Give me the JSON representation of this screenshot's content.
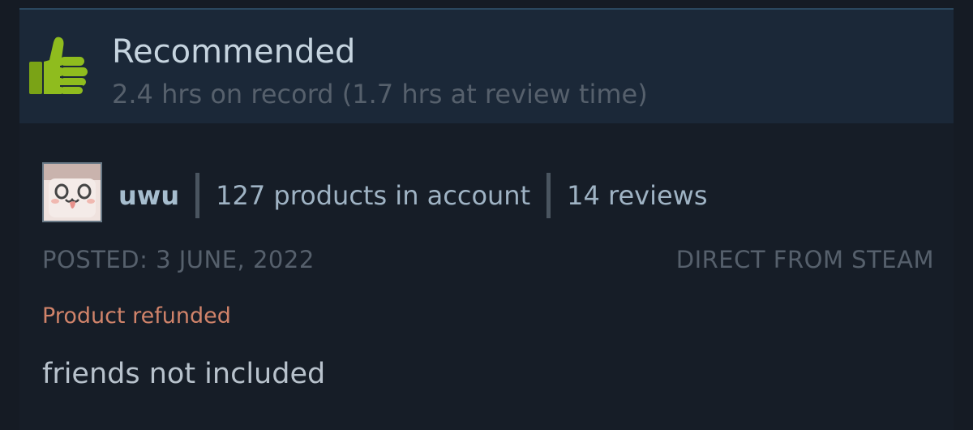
{
  "review": {
    "verdict": "Recommended",
    "hours": "2.4 hrs on record (1.7 hrs at review time)",
    "author": {
      "name": "uwu",
      "products": "127 products in account",
      "reviews": "14 reviews"
    },
    "posted": "POSTED: 3 JUNE, 2022",
    "source": "DIRECT FROM STEAM",
    "status": "Product refunded",
    "body": "friends not included"
  },
  "icons": {
    "verdict": "thumbs-up-icon",
    "avatar": "avatar"
  },
  "colors": {
    "background": "#151b24",
    "header_background": "#1b2838",
    "thumbs_up_green": "#8fbc1e",
    "title_text": "#c6d4df",
    "muted_text": "#56606c",
    "refunded_text": "#d0836a",
    "body_text": "#b8c2cc"
  }
}
